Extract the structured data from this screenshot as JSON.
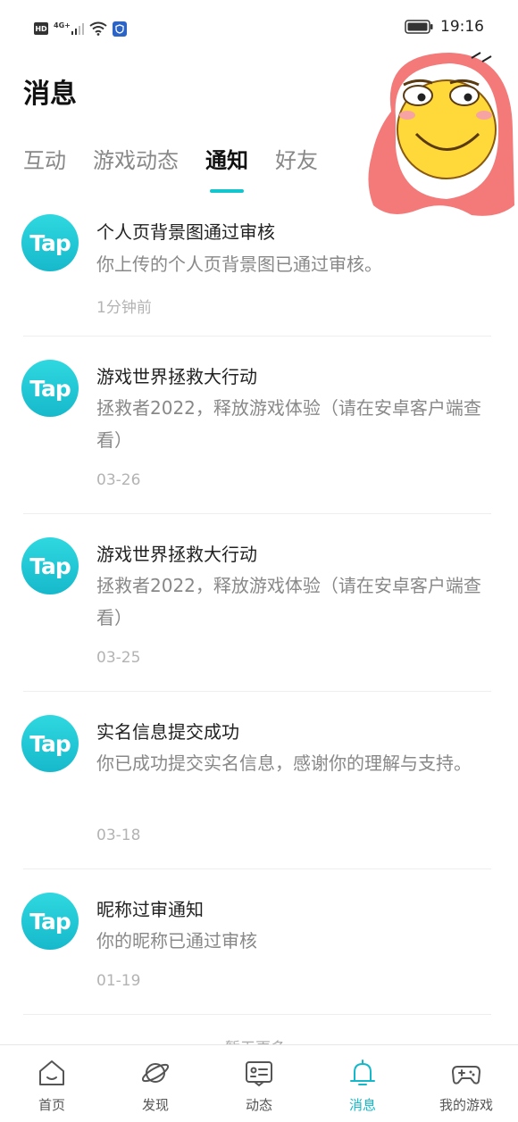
{
  "status_bar": {
    "hd": "HD",
    "network": "4G+",
    "time": "19:16"
  },
  "page": {
    "title": "消息"
  },
  "tabs": [
    {
      "label": "互动",
      "active": false
    },
    {
      "label": "游戏动态",
      "active": false
    },
    {
      "label": "通知",
      "active": true
    },
    {
      "label": "好友",
      "active": false
    }
  ],
  "accent_color": "#15c5ce",
  "notifications": [
    {
      "avatar": "Tap",
      "title": "个人页背景图通过审核",
      "body": "你上传的个人页背景图已通过审核。",
      "time": "1分钟前"
    },
    {
      "avatar": "Tap",
      "title": "游戏世界拯救大行动",
      "body": "拯救者2022，释放游戏体验（请在安卓客户端查看）",
      "time": "03-26"
    },
    {
      "avatar": "Tap",
      "title": "游戏世界拯救大行动",
      "body": "拯救者2022，释放游戏体验（请在安卓客户端查看）",
      "time": "03-25"
    },
    {
      "avatar": "Tap",
      "title": "实名信息提交成功",
      "body": "你已成功提交实名信息，感谢你的理解与支持。",
      "time": "03-18"
    },
    {
      "avatar": "Tap",
      "title": "昵称过审通知",
      "body": "你的昵称已通过审核",
      "time": "01-19"
    }
  ],
  "footer_hint": "暂无更多",
  "bottom_nav": [
    {
      "label": "首页",
      "icon": "home-icon",
      "active": false
    },
    {
      "label": "发现",
      "icon": "planet-icon",
      "active": false
    },
    {
      "label": "动态",
      "icon": "feed-icon",
      "active": false
    },
    {
      "label": "消息",
      "icon": "bell-icon",
      "active": true
    },
    {
      "label": "我的游戏",
      "icon": "gamepad-icon",
      "active": false
    }
  ]
}
